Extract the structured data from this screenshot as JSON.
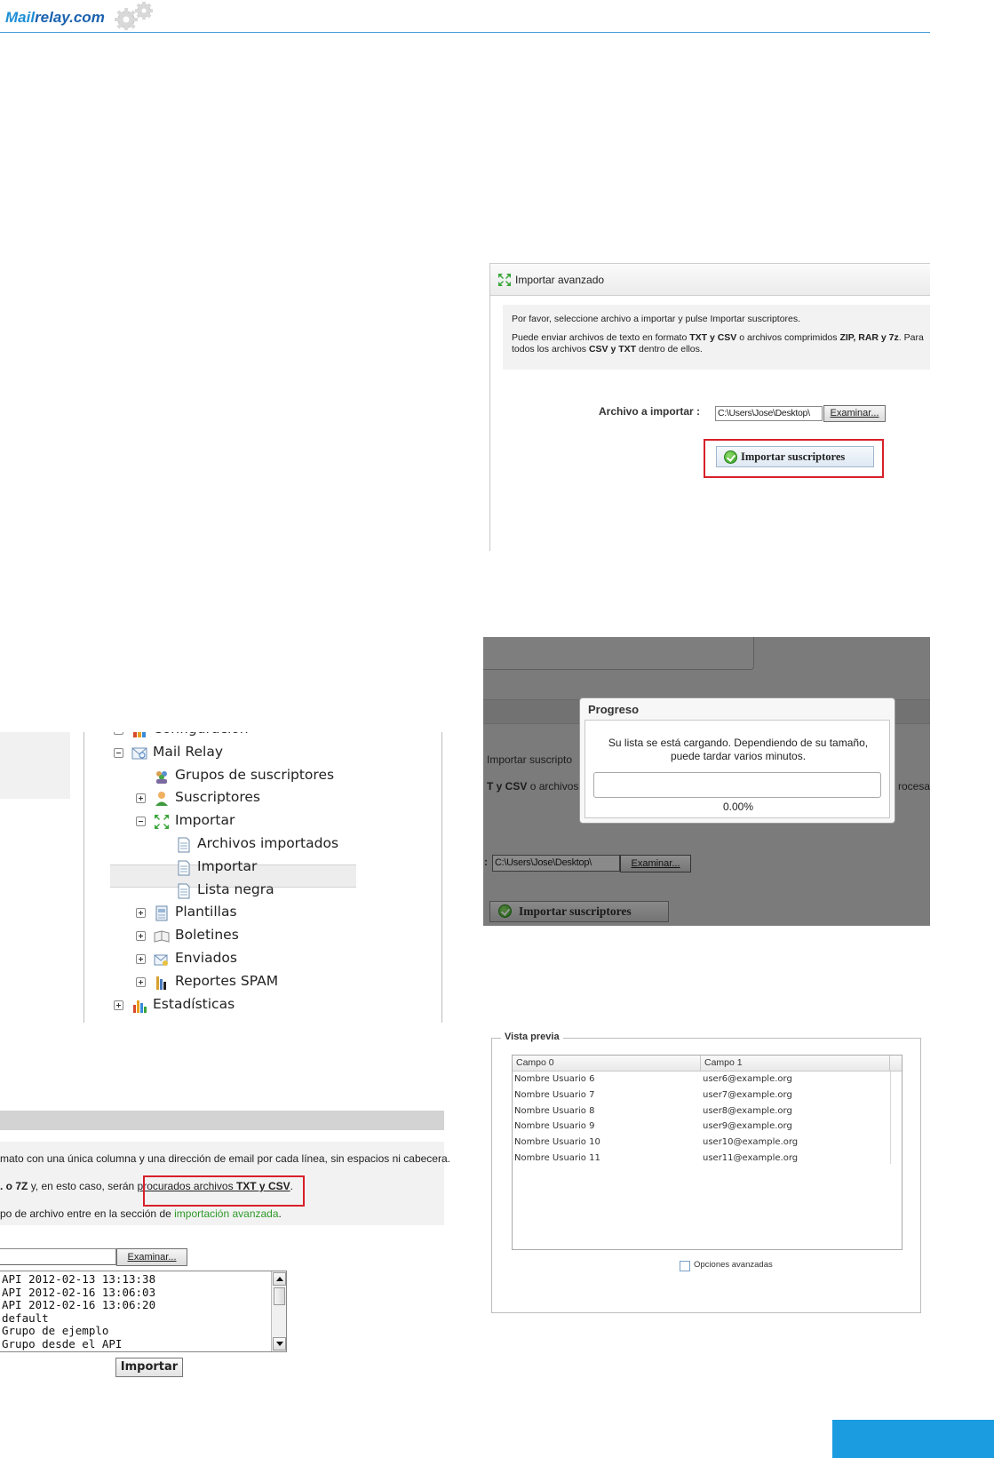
{
  "header": {
    "brand_prefix": "Mail",
    "brand_suffix": "relay.com"
  },
  "advanced_import": {
    "title": "Importar avanzado",
    "info_line1": "Por favor, seleccione archivo a importar y pulse Importar suscriptores.",
    "info_line2_a": "Puede enviar archivos de texto en formato ",
    "info_line2_b": "TXT y CSV",
    "info_line2_c": " o archivos comprimidos ",
    "info_line2_d": "ZIP, RAR y 7z",
    "info_line2_e": ". Para",
    "info_line3_a": "todos los archivos ",
    "info_line3_b": "CSV y TXT",
    "info_line3_c": " dentro de ellos.",
    "file_label": "Archivo a importar :",
    "file_value": "C:\\Users\\Jose\\Desktop\\",
    "browse_label": "Examinar...",
    "import_label": "Importar suscriptores"
  },
  "progress": {
    "bg_text1": "Importar suscripto",
    "bg_text2_a": "T y CSV",
    "bg_text2_b": " o archivos",
    "bg_text3": "rocesa",
    "file_prefix": ":",
    "file_value": "C:\\Users\\Jose\\Desktop\\",
    "browse_label": "Examinar...",
    "import_label": "Importar suscriptores",
    "modal_title": "Progreso",
    "modal_msg1": "Su lista se está cargando. Dependiendo de su tamaño,",
    "modal_msg2": "puede tardar varios minutos.",
    "percent_text": "0.00%",
    "percent_value": 0
  },
  "tree": {
    "items": [
      {
        "label": "Configuración",
        "level": 0,
        "exp": "plus",
        "icon": "config-icon"
      },
      {
        "label": "Mail Relay",
        "level": 0,
        "exp": "minus",
        "icon": "mail-icon"
      },
      {
        "label": "Grupos de suscriptores",
        "level": 1,
        "exp": "",
        "icon": "groups-icon"
      },
      {
        "label": "Suscriptores",
        "level": 1,
        "exp": "plus",
        "icon": "user-icon"
      },
      {
        "label": "Importar",
        "level": 1,
        "exp": "minus",
        "icon": "import-icon"
      },
      {
        "label": "Archivos importados",
        "level": 2,
        "exp": "",
        "icon": "document-icon"
      },
      {
        "label": "Importar",
        "level": 2,
        "exp": "",
        "icon": "document-icon"
      },
      {
        "label": "Lista negra",
        "level": 2,
        "exp": "",
        "icon": "document-icon"
      },
      {
        "label": "Plantillas",
        "level": 1,
        "exp": "plus",
        "icon": "template-icon"
      },
      {
        "label": "Boletines",
        "level": 1,
        "exp": "plus",
        "icon": "newsletter-icon"
      },
      {
        "label": "Enviados",
        "level": 1,
        "exp": "plus",
        "icon": "sent-icon"
      },
      {
        "label": "Reportes SPAM",
        "level": 1,
        "exp": "plus",
        "icon": "spam-report-icon"
      },
      {
        "label": "Estadísticas",
        "level": 0,
        "exp": "plus",
        "icon": "stats-icon"
      }
    ]
  },
  "preview": {
    "legend": "Vista previa",
    "columns": [
      "Campo 0",
      "Campo 1"
    ],
    "rows": [
      [
        "Nombre Usuario 6",
        "user6@example.org"
      ],
      [
        "Nombre Usuario 7",
        "user7@example.org"
      ],
      [
        "Nombre Usuario 8",
        "user8@example.org"
      ],
      [
        "Nombre Usuario 9",
        "user9@example.org"
      ],
      [
        "Nombre Usuario 10",
        "user10@example.org"
      ],
      [
        "Nombre Usuario 11",
        "user11@example.org"
      ]
    ],
    "advanced_options_label": "Opciones avanzadas"
  },
  "simple_import": {
    "line1": "mato con una única columna y una dirección de email por cada línea, sin espacios ni cabecera.",
    "line2_a": ". o ",
    "line2_b": "7Z",
    "line2_c": " y, en esto caso, serán ",
    "line2_d": "procurados archivos ",
    "line2_e": "TXT y CSV",
    "line2_f": ".",
    "line3_a": "po de archivo entre en la sección de ",
    "line3_link": "importación avanzada",
    "line3_b": ".",
    "browse_label": "Examinar...",
    "groups": [
      "API 2012-02-13 13:13:38",
      "API 2012-02-16 13:06:03",
      "API 2012-02-16 13:06:20",
      "default",
      "Grupo de ejemplo",
      "Grupo desde el API"
    ],
    "import_label": "Importar"
  },
  "colors": {
    "brand_blue": "#1a62b0",
    "highlight_red": "#d8202a",
    "link_green": "#2e9a28",
    "page_tab_blue": "#1b9be0"
  }
}
